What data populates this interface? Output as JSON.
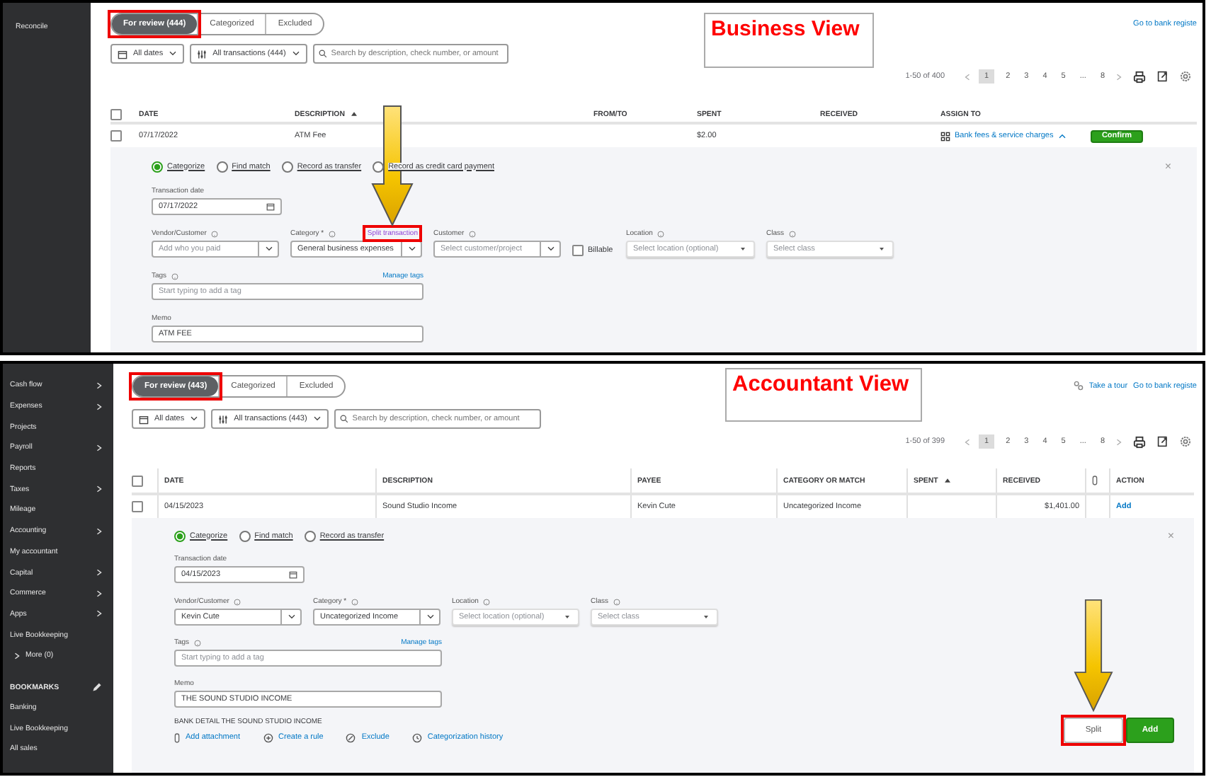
{
  "views": [
    {
      "kind": "business",
      "sidebar": [
        {
          "kind": "link",
          "label": "Reconcile"
        }
      ],
      "tabs": [
        {
          "label": "For review (444)",
          "selected": true,
          "highlighted": true
        },
        {
          "label": "Categorized",
          "selected": false,
          "highlighted": false
        },
        {
          "label": "Excluded",
          "selected": false,
          "highlighted": false
        }
      ],
      "view_label": "Business View",
      "top_links": [
        {
          "kind": "link",
          "label": "Go to bank registe"
        }
      ],
      "filters": {
        "dates": "All dates",
        "transactions": "All transactions (444)",
        "search_placeholder": "Search by description, check number, or amount"
      },
      "pagination": {
        "range": "1-50 of 400",
        "pages": [
          {
            "label": "1",
            "selected": true
          },
          {
            "label": "2",
            "selected": false
          },
          {
            "label": "3",
            "selected": false
          },
          {
            "label": "4",
            "selected": false
          },
          {
            "label": "5",
            "selected": false
          },
          {
            "label": "...",
            "selected": false
          },
          {
            "label": "8",
            "selected": false
          }
        ]
      },
      "table": {
        "all_checked": false,
        "columns": [
          {
            "kind": "text",
            "label": "DATE",
            "sorted": false
          },
          {
            "kind": "text",
            "label": "DESCRIPTION",
            "sorted": true
          },
          {
            "kind": "text",
            "label": "FROM/TO",
            "sorted": false
          },
          {
            "kind": "text",
            "label": "SPENT",
            "sorted": false
          },
          {
            "kind": "text",
            "label": "RECEIVED",
            "sorted": false
          },
          {
            "kind": "text",
            "label": "ASSIGN TO",
            "sorted": false
          },
          {
            "kind": "blank"
          }
        ],
        "row": {
          "checked": false,
          "cells": [
            {
              "kind": "text",
              "text": "07/17/2022"
            },
            {
              "kind": "text",
              "text": "ATM Fee"
            },
            {
              "kind": "blank"
            },
            {
              "kind": "text",
              "text": "$2.00"
            },
            {
              "kind": "blank"
            },
            {
              "kind": "assign",
              "text": "Bank fees & service charges",
              "expanded": true
            },
            {
              "kind": "button",
              "text": "Confirm"
            }
          ]
        }
      },
      "details": {
        "radios": [
          {
            "label": "Categorize",
            "selected": true
          },
          {
            "label": "Find match",
            "selected": false
          },
          {
            "label": "Record as transfer",
            "selected": false
          },
          {
            "label": "Record as credit card payment",
            "selected": false
          }
        ],
        "close": "×",
        "date": {
          "label": "Transaction date",
          "value": "07/17/2022"
        },
        "fields": [
          {
            "kind": "combo",
            "label": "Vendor/Customer",
            "help": true,
            "placeholder": "Add who you paid"
          },
          {
            "kind": "combo",
            "label": "Category *",
            "help": true,
            "value": "General business expenses",
            "link": {
              "label": "Split transaction",
              "highlighted": true,
              "arrow": true
            }
          },
          {
            "kind": "combo",
            "label": "Customer",
            "help": true,
            "placeholder": "Select customer/project"
          },
          {
            "kind": "checkbox",
            "label": "Billable",
            "checked": false
          },
          {
            "kind": "select",
            "label": "Location",
            "help": true,
            "placeholder": "Select location (optional)"
          },
          {
            "kind": "select",
            "label": "Class",
            "help": true,
            "placeholder": "Select class"
          }
        ],
        "tags": {
          "label": "Tags",
          "help": true,
          "link": "Manage tags",
          "placeholder": "Start typing to add a tag"
        },
        "memo": {
          "label": "Memo",
          "value": "ATM FEE"
        }
      }
    },
    {
      "kind": "accountant",
      "sidebar": [
        {
          "kind": "menu",
          "label": "Cash flow"
        },
        {
          "kind": "menu",
          "label": "Expenses"
        },
        {
          "kind": "link",
          "label": "Projects"
        },
        {
          "kind": "menu",
          "label": "Payroll"
        },
        {
          "kind": "link",
          "label": "Reports"
        },
        {
          "kind": "menu",
          "label": "Taxes"
        },
        {
          "kind": "link",
          "label": "Mileage"
        },
        {
          "kind": "menu",
          "label": "Accounting"
        },
        {
          "kind": "link",
          "label": "My accountant"
        },
        {
          "kind": "menu",
          "label": "Capital"
        },
        {
          "kind": "menu",
          "label": "Commerce"
        },
        {
          "kind": "menu",
          "label": "Apps"
        },
        {
          "kind": "link",
          "label": "Live Bookkeeping"
        },
        {
          "kind": "more",
          "label": "More (0)"
        },
        {
          "kind": "header",
          "label": "BOOKMARKS"
        },
        {
          "kind": "link",
          "label": "Banking"
        },
        {
          "kind": "link",
          "label": "Live Bookkeeping"
        },
        {
          "kind": "link",
          "label": "All sales"
        }
      ],
      "tabs": [
        {
          "label": "For review (443)",
          "selected": true,
          "highlighted": true
        },
        {
          "label": "Categorized",
          "selected": false,
          "highlighted": false
        },
        {
          "label": "Excluded",
          "selected": false,
          "highlighted": false
        }
      ],
      "view_label": "Accountant View",
      "top_links": [
        {
          "kind": "tour",
          "label": "Take a tour"
        },
        {
          "kind": "link",
          "label": "Go to bank registe"
        }
      ],
      "filters": {
        "dates": "All dates",
        "transactions": "All transactions (443)",
        "search_placeholder": "Search by description, check number, or amount"
      },
      "pagination": {
        "range": "1-50 of 399",
        "pages": [
          {
            "label": "1",
            "selected": true
          },
          {
            "label": "2",
            "selected": false
          },
          {
            "label": "3",
            "selected": false
          },
          {
            "label": "4",
            "selected": false
          },
          {
            "label": "5",
            "selected": false
          },
          {
            "label": "...",
            "selected": false
          },
          {
            "label": "8",
            "selected": false
          }
        ]
      },
      "table": {
        "all_checked": false,
        "columns": [
          {
            "kind": "text",
            "label": "DATE",
            "sorted": false
          },
          {
            "kind": "text",
            "label": "DESCRIPTION",
            "sorted": false
          },
          {
            "kind": "text",
            "label": "PAYEE",
            "sorted": false
          },
          {
            "kind": "text",
            "label": "CATEGORY OR MATCH",
            "sorted": false
          },
          {
            "kind": "text",
            "label": "SPENT",
            "sorted": true
          },
          {
            "kind": "text",
            "label": "RECEIVED",
            "sorted": false
          },
          {
            "kind": "attachment"
          },
          {
            "kind": "text",
            "label": "ACTION",
            "sorted": false
          }
        ],
        "row": {
          "checked": false,
          "cells": [
            {
              "kind": "text",
              "text": "04/15/2023"
            },
            {
              "kind": "text",
              "text": "Sound Studio Income"
            },
            {
              "kind": "text",
              "text": "Kevin Cute"
            },
            {
              "kind": "text",
              "text": "Uncategorized Income"
            },
            {
              "kind": "blank"
            },
            {
              "kind": "amount",
              "text": "$1,401.00"
            },
            {
              "kind": "blank"
            },
            {
              "kind": "link",
              "text": "Add"
            }
          ]
        }
      },
      "details": {
        "radios": [
          {
            "label": "Categorize",
            "selected": true
          },
          {
            "label": "Find match",
            "selected": false
          },
          {
            "label": "Record as transfer",
            "selected": false
          }
        ],
        "close": "×",
        "date": {
          "label": "Transaction date",
          "value": "04/15/2023"
        },
        "fields": [
          {
            "kind": "combo",
            "label": "Vendor/Customer",
            "help": true,
            "value": "Kevin Cute"
          },
          {
            "kind": "combo",
            "label": "Category *",
            "help": true,
            "value": "Uncategorized Income"
          },
          {
            "kind": "select",
            "label": "Location",
            "help": true,
            "placeholder": "Select location (optional)"
          },
          {
            "kind": "select",
            "label": "Class",
            "help": true,
            "placeholder": "Select class"
          }
        ],
        "tags": {
          "label": "Tags",
          "help": true,
          "link": "Manage tags",
          "placeholder": "Start typing to add a tag"
        },
        "memo": {
          "label": "Memo",
          "value": "THE SOUND STUDIO INCOME"
        },
        "bank_detail": "BANK DETAIL THE SOUND STUDIO INCOME",
        "footer_links": [
          {
            "kind": "attachment",
            "label": "Add attachment"
          },
          {
            "kind": "rule",
            "label": "Create a rule"
          },
          {
            "kind": "exclude",
            "label": "Exclude"
          },
          {
            "kind": "history",
            "label": "Categorization history"
          }
        ],
        "buttons": [
          {
            "kind": "secondary",
            "label": "Split",
            "highlighted": true,
            "arrow": true
          },
          {
            "kind": "primary",
            "label": "Add",
            "highlighted": false,
            "arrow": false
          }
        ]
      }
    }
  ]
}
